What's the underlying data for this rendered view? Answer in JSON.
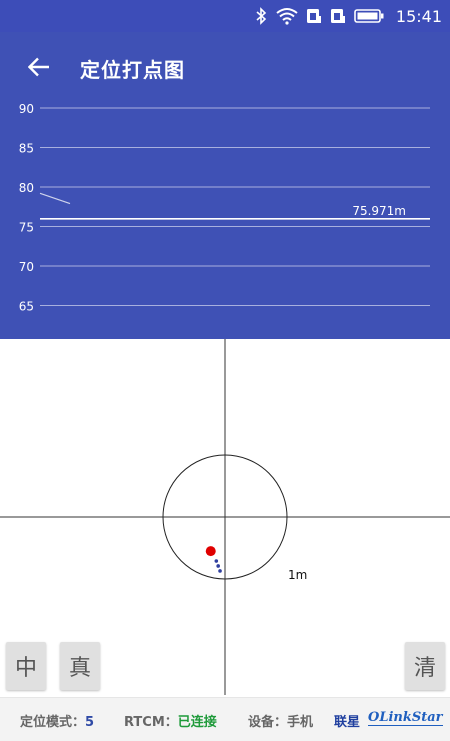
{
  "status_bar": {
    "time": "15:41",
    "icons": [
      "bluetooth-icon",
      "wifi-icon",
      "sim1-icon",
      "sim2-icon",
      "battery-icon"
    ]
  },
  "app_bar": {
    "title": "定位打点图",
    "back_icon": "arrow-left-icon"
  },
  "colors": {
    "primary": "#3f51b5",
    "status_bar": "#3d4db8",
    "mode_value": "#2f4aa6",
    "connected": "#1e9a3a",
    "point_primary": "#e00000",
    "point_secondary": "#2f3f9f"
  },
  "chart_data": {
    "type": "line",
    "y_ticks": [
      90,
      85,
      80,
      75,
      70,
      65
    ],
    "ylim": [
      62.5,
      91.5
    ],
    "grid": true,
    "series": [
      {
        "values": [
          79.2,
          77.9
        ]
      }
    ],
    "reference_line": {
      "value": 75.971,
      "label": "75.971m"
    }
  },
  "plot": {
    "type": "scatter",
    "ring_radius_m": 1,
    "ring_label": "1m",
    "points": [
      {
        "x": -0.23,
        "y": -0.55,
        "kind": "current"
      },
      {
        "x": -0.14,
        "y": -0.71,
        "kind": "history"
      },
      {
        "x": -0.11,
        "y": -0.79,
        "kind": "history"
      },
      {
        "x": -0.08,
        "y": -0.87,
        "kind": "history"
      }
    ]
  },
  "buttons": {
    "center": "中",
    "true": "真",
    "clear": "清"
  },
  "footer": {
    "mode_label": "定位模式：",
    "mode_value": "5",
    "rtcm_label": "RTCM：",
    "rtcm_value": "已连接",
    "device_label": "设备：",
    "device_value": "手机",
    "brand_cn": "联星",
    "brand_en": "OLinkStar"
  }
}
